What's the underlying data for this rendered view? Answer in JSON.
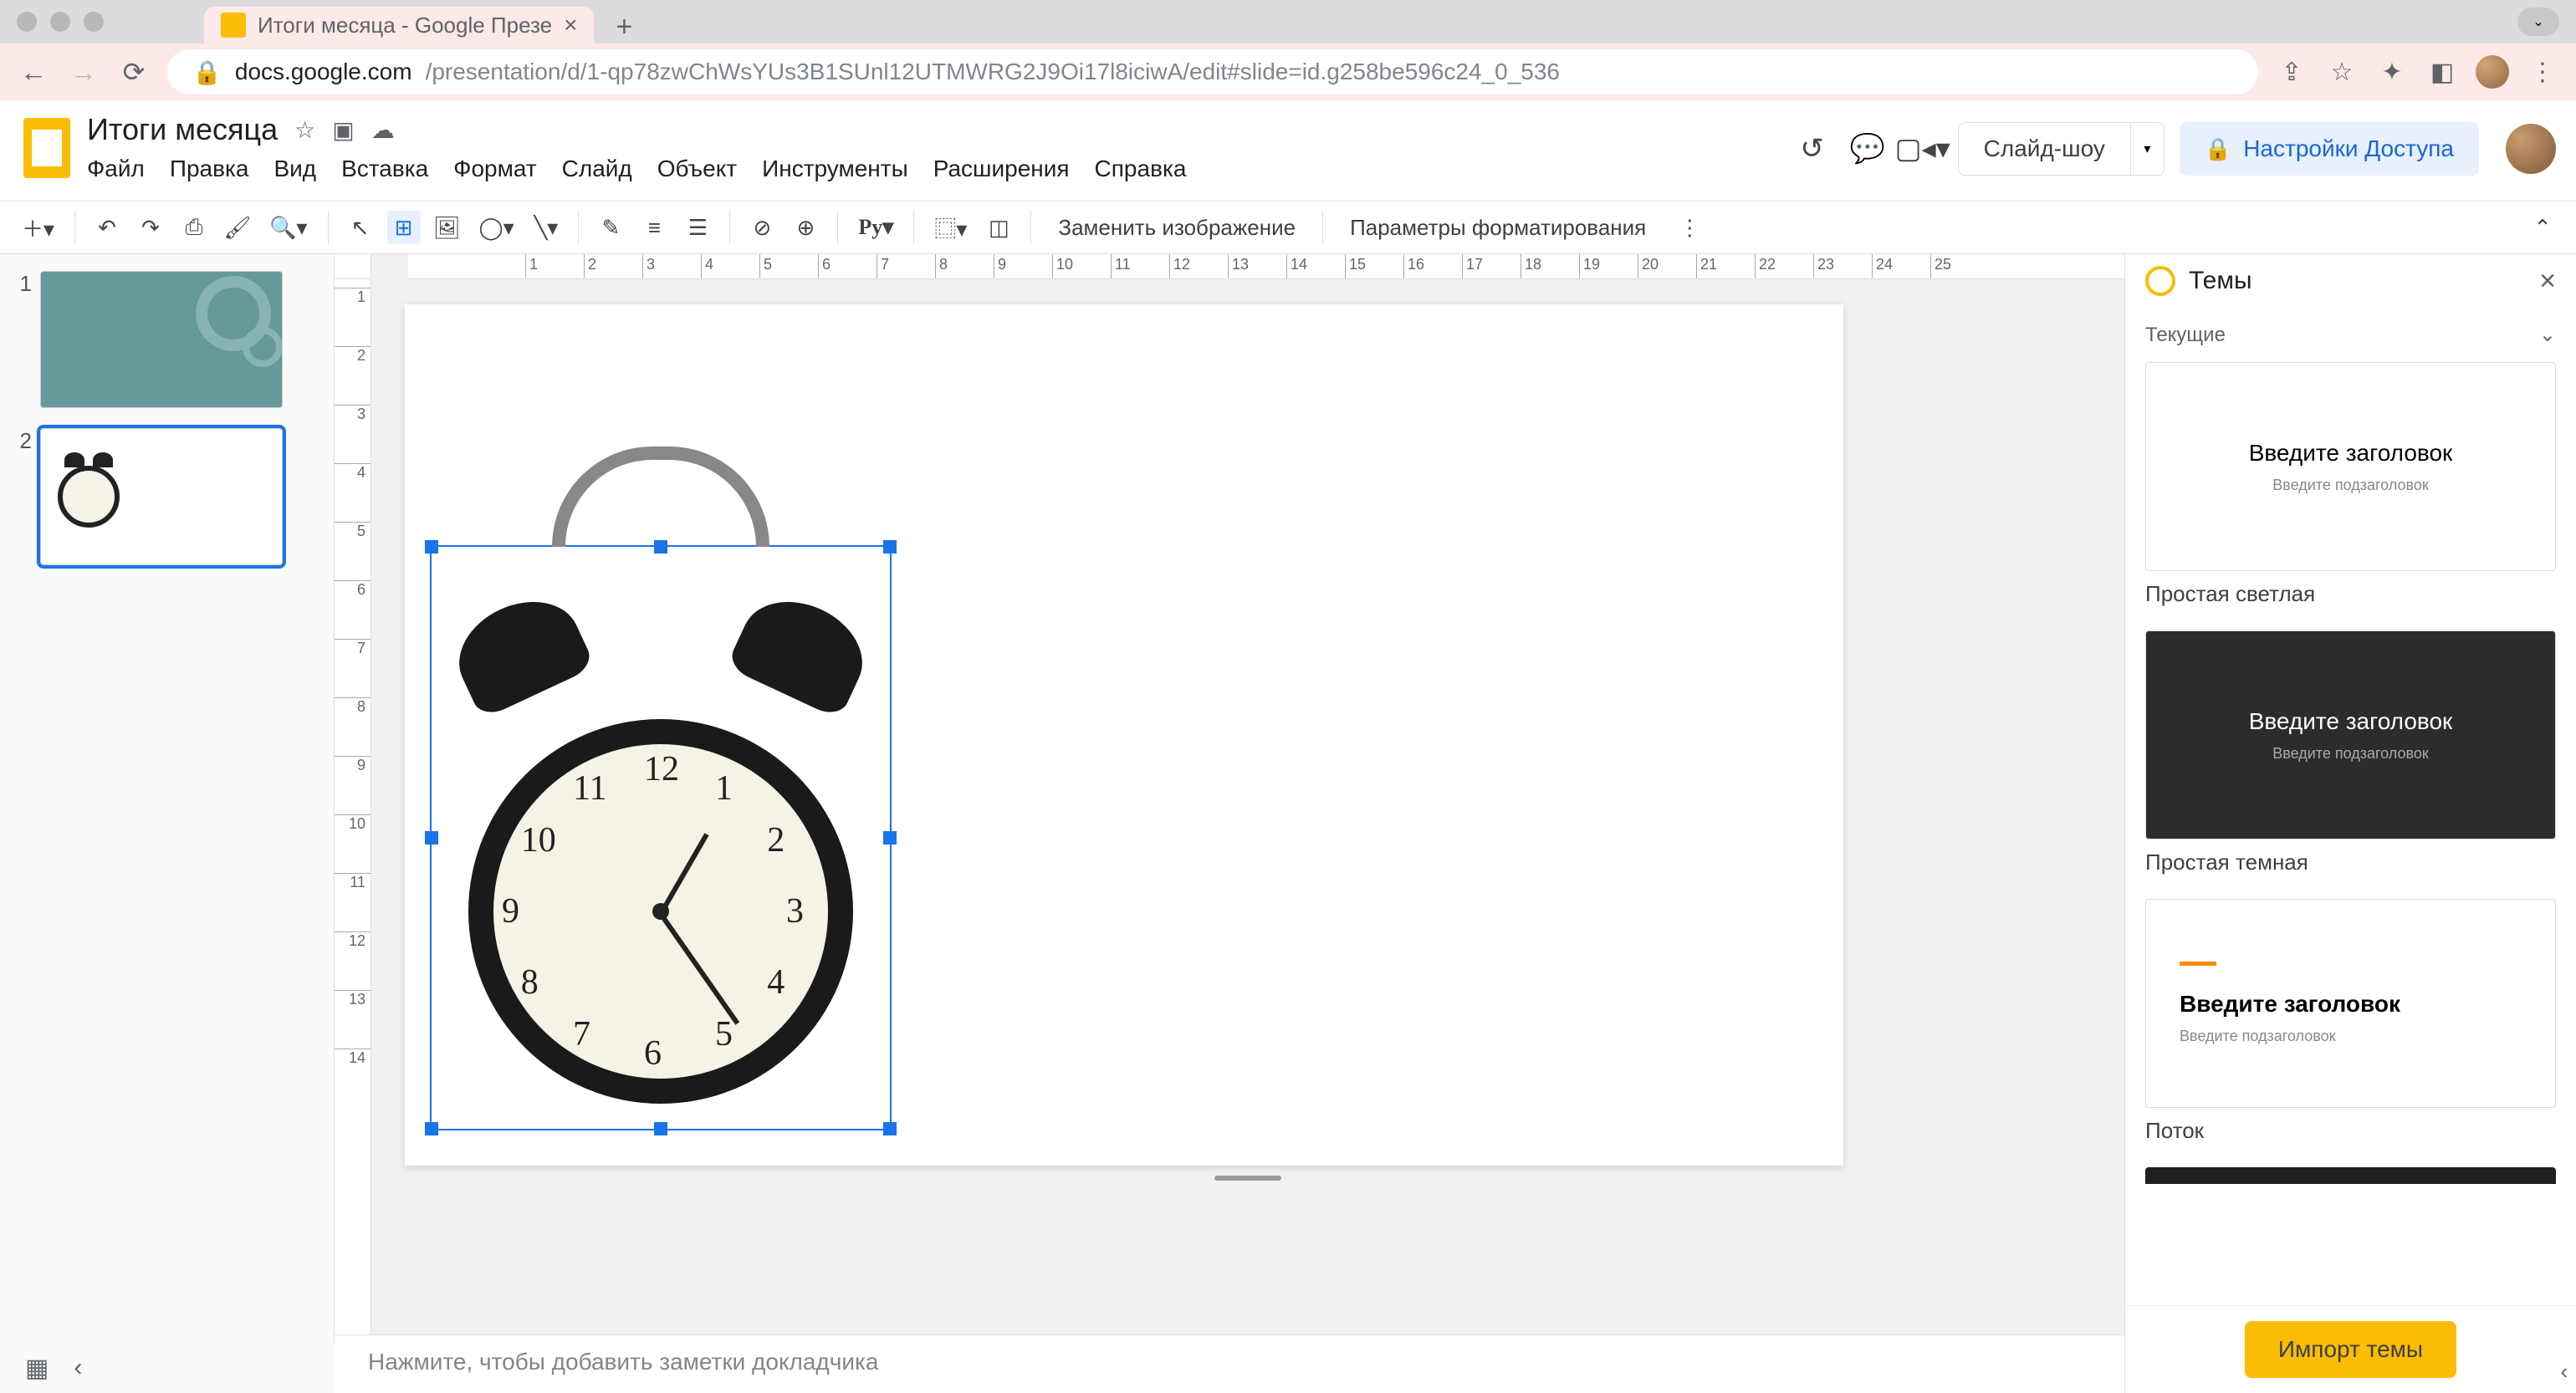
{
  "browser": {
    "tab_title": "Итоги месяца - Google Презе",
    "url_domain": "docs.google.com",
    "url_path": "/presentation/d/1-qp78zwChWsYUs3B1SUnl12UTMWRG2J9Oi17l8iciwA/edit#slide=id.g258be596c24_0_536"
  },
  "doc": {
    "title": "Итоги месяца",
    "menus": [
      "Файл",
      "Правка",
      "Вид",
      "Вставка",
      "Формат",
      "Слайд",
      "Объект",
      "Инструменты",
      "Расширения",
      "Справка"
    ]
  },
  "header": {
    "slideshow": "Слайд-шоу",
    "share": "Настройки Доступа"
  },
  "toolbar": {
    "replace_image": "Заменить изображение",
    "format_options": "Параметры форматирования"
  },
  "filmstrip": {
    "slides": [
      {
        "num": "1"
      },
      {
        "num": "2"
      }
    ]
  },
  "canvas": {
    "clock_numbers": [
      "12",
      "1",
      "2",
      "3",
      "4",
      "5",
      "6",
      "7",
      "8",
      "9",
      "10",
      "11"
    ]
  },
  "notes": {
    "placeholder": "Нажмите, чтобы добавить заметки докладчика"
  },
  "themes": {
    "title": "Темы",
    "current": "Текущие",
    "card_title": "Введите заголовок",
    "card_subtitle": "Введите подзаголовок",
    "labels": {
      "light": "Простая светлая",
      "dark": "Простая темная",
      "stream": "Поток"
    },
    "import": "Импорт темы"
  },
  "ruler_h": [
    "1",
    "2",
    "3",
    "4",
    "5",
    "6",
    "7",
    "8",
    "9",
    "10",
    "11",
    "12",
    "13",
    "14",
    "15",
    "16",
    "17",
    "18",
    "19",
    "20",
    "21",
    "22",
    "23",
    "24",
    "25"
  ],
  "ruler_v": [
    "1",
    "2",
    "3",
    "4",
    "5",
    "6",
    "7",
    "8",
    "9",
    "10",
    "11",
    "12",
    "13",
    "14"
  ]
}
